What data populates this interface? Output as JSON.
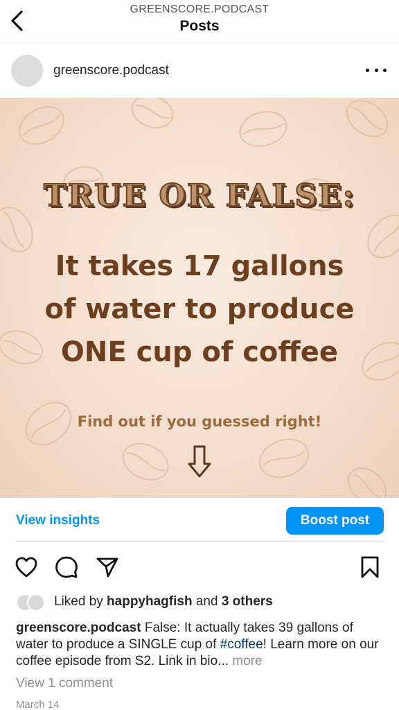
{
  "header": {
    "subtitle": "GREENSCORE.PODCAST",
    "title": "Posts",
    "back_icon": "chevron-left-icon"
  },
  "post": {
    "author": "greenscore.podcast",
    "more_icon": "more-horizontal-icon",
    "image": {
      "headline": "TRUE OR FALSE:",
      "body_lines": [
        "It takes 17 gallons",
        "of water to produce",
        "ONE cup of coffee"
      ],
      "cta": "Find out if you guessed right!",
      "arrow_icon": "arrow-down-icon"
    },
    "insights": {
      "view_insights_label": "View insights",
      "boost_label": "Boost post"
    },
    "actions": [
      "heart-icon",
      "comment-icon",
      "share-icon",
      "bookmark-icon"
    ],
    "likes": {
      "prefix": "Liked by ",
      "user": "happyhagfish",
      "middle": " and ",
      "others": "3 others"
    },
    "caption": {
      "username": "greenscore.podcast",
      "text_before_tag": " False: It actually takes 39 gallons of water to produce a SINGLE cup of ",
      "hashtag": "#coffee",
      "text_after_tag": "! Learn more on our coffee episode from S2. Link in bio... ",
      "more_label": "more"
    },
    "view_comments_label": "View 1 comment",
    "date": "March 14"
  },
  "colors": {
    "accent": "#0095f6",
    "hashtag": "#00376b",
    "muted": "#8e8e8e",
    "image_text": "#6b3f20"
  }
}
